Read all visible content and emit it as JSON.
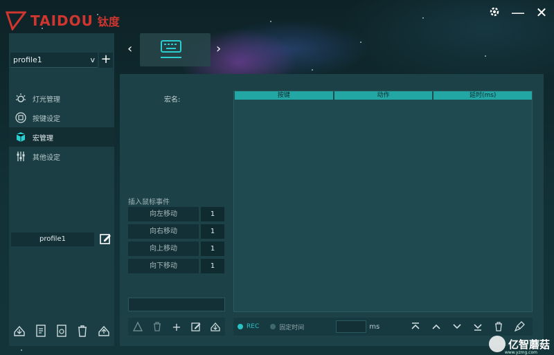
{
  "brand": {
    "name": "TAIDOU",
    "cn": "钛度",
    "color": "#d0362f"
  },
  "window": {
    "settings_icon": "gear-icon",
    "minimize": "—",
    "close": "✕"
  },
  "device": {
    "prev": "‹",
    "next": "›",
    "icon": "keyboard-icon",
    "accent": "#2bcfcf"
  },
  "sidebar": {
    "profile_selected": "profile1",
    "caret": "v",
    "add_label": "+",
    "items": [
      {
        "label": "灯光管理",
        "icon": "light-icon"
      },
      {
        "label": "按键设定",
        "icon": "keys-icon"
      },
      {
        "label": "宏管理",
        "icon": "macro-box-icon",
        "active": true
      },
      {
        "label": "其他设定",
        "icon": "sliders-icon"
      }
    ],
    "profile_name": "profile1"
  },
  "macro": {
    "name_label": "宏名:",
    "insert_label": "插入鼠标事件",
    "moves": [
      {
        "label": "向左移动",
        "value": "1"
      },
      {
        "label": "向右移动",
        "value": "1"
      },
      {
        "label": "向上移动",
        "value": "1"
      },
      {
        "label": "向下移动",
        "value": "1"
      }
    ],
    "tool_add": "+"
  },
  "table": {
    "columns": [
      "按键",
      "动作",
      "延时(ms)"
    ]
  },
  "bottom": {
    "rec_label": "REC",
    "fixed_time_label": "固定时间",
    "ms_label": "ms",
    "rec_color": "#27c3c3"
  },
  "watermark": {
    "text": "亿智蘑菇",
    "sub": "www.yzmg.com"
  }
}
